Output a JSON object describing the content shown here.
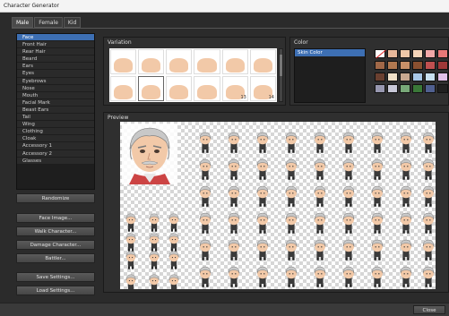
{
  "window": {
    "title": "Character Generator"
  },
  "tabs": [
    {
      "label": "Male",
      "active": true
    },
    {
      "label": "Female",
      "active": false
    },
    {
      "label": "Kid",
      "active": false
    }
  ],
  "parts": [
    {
      "label": "Face",
      "selected": true
    },
    {
      "label": "Front Hair"
    },
    {
      "label": "Rear Hair"
    },
    {
      "label": "Beard"
    },
    {
      "label": "Ears"
    },
    {
      "label": "Eyes"
    },
    {
      "label": "Eyebrows"
    },
    {
      "label": "Nose"
    },
    {
      "label": "Mouth"
    },
    {
      "label": "Facial Mark"
    },
    {
      "label": "Beast Ears"
    },
    {
      "label": "Tail"
    },
    {
      "label": "Wing"
    },
    {
      "label": "Clothing"
    },
    {
      "label": "Cloak"
    },
    {
      "label": "Accessory 1"
    },
    {
      "label": "Accessory 2"
    },
    {
      "label": "Glasses"
    }
  ],
  "buttons": {
    "randomize": "Randomize",
    "face_image": "Face Image...",
    "walk_character": "Walk Character...",
    "damage_character": "Damage Character...",
    "battler": "Battler...",
    "save_settings": "Save Settings...",
    "load_settings": "Load Settings...",
    "close": "Close"
  },
  "variation": {
    "title": "Variation",
    "selected_index": 7,
    "numbers": [
      "",
      "",
      "",
      "",
      "",
      "",
      "",
      "",
      "",
      "",
      "13",
      "14"
    ]
  },
  "color": {
    "title": "Color",
    "list": [
      "Skin Color"
    ],
    "swatches": [
      "none",
      "#e8b89a",
      "#f0c8a8",
      "#f5d4b8",
      "#f1a8a8",
      "#e87878",
      "#a06848",
      "#b07850",
      "#c89068",
      "#8a5030",
      "#c05050",
      "#a03838",
      "#6a4030",
      "#f0e0c8",
      "#c8a890",
      "#a8c8e8",
      "#c8e0f0",
      "#e0c0e8",
      "#9898b0",
      "#c8c8d8",
      "#78a878",
      "#3a7838",
      "#506090",
      "#202020"
    ]
  },
  "preview": {
    "title": "Preview"
  },
  "colors": {
    "skin": "#f2c9a8",
    "hair": "#c8c8c8",
    "selection": "#3d6fb3"
  }
}
